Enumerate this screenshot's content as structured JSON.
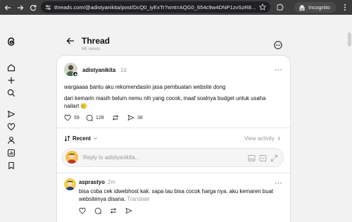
{
  "browser": {
    "url": "threads.com/@adistyanikita/post/DcQ0_iyExTr?xmt=AQG0_654c9w4DNP1zvSzR8...",
    "incognito_label": "Incognito"
  },
  "sidebar": {
    "icons": [
      "threads-logo-icon",
      "home-icon",
      "plus-icon",
      "search-icon",
      "send-icon",
      "heart-icon",
      "profile-icon",
      "insights-icon",
      "bookmark-icon"
    ]
  },
  "header": {
    "title": "Thread",
    "views": "6K views"
  },
  "post": {
    "username": "adistyanikita",
    "time": "1d",
    "text1": "wargaaaa bantu aku rekomendasiin jasa pembuatan website dong",
    "text2": "dari kemarin masih belum nemu nih yang cocok, maaf soalnya budget untuk usaha nailart 🥲",
    "likes": "59",
    "comments": "128",
    "shares": "38"
  },
  "sort": {
    "label": "Recent",
    "view_activity": "View activity"
  },
  "reply": {
    "placeholder": "Reply to adistyanikita..."
  },
  "comment": {
    "username": "asprastyo",
    "time": "2m",
    "text": "bisa coba cek idwebhost kak. sapa tau bisa cocok harga nya. aku kemaren buat websitenya disana.",
    "translate": "Translate"
  },
  "colors": {
    "chrome": "#3c3c3c",
    "page_bg": "#f2f2f2",
    "card_bg": "#ffffff",
    "muted": "#999999"
  }
}
